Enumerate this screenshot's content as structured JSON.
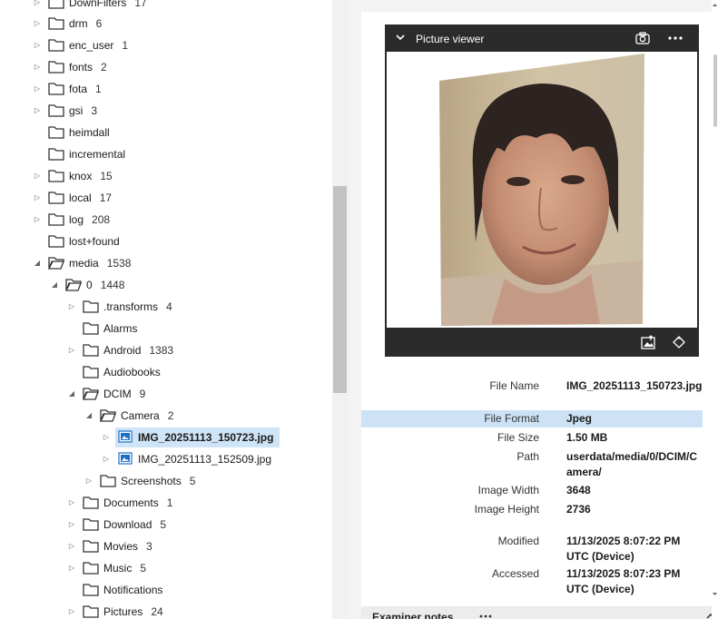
{
  "tree": {
    "rows": [
      {
        "label": "DownFilters",
        "count": "17"
      },
      {
        "label": "drm",
        "count": "6"
      },
      {
        "label": "enc_user",
        "count": "1"
      },
      {
        "label": "fonts",
        "count": "2"
      },
      {
        "label": "fota",
        "count": "1"
      },
      {
        "label": "gsi",
        "count": "3"
      },
      {
        "label": "heimdall",
        "count": ""
      },
      {
        "label": "incremental",
        "count": ""
      },
      {
        "label": "knox",
        "count": "15"
      },
      {
        "label": "local",
        "count": "17"
      },
      {
        "label": "log",
        "count": "208"
      },
      {
        "label": "lost+found",
        "count": ""
      },
      {
        "label": "media",
        "count": "1538"
      },
      {
        "label": "0",
        "count": "1448"
      },
      {
        "label": ".transforms",
        "count": "4"
      },
      {
        "label": "Alarms",
        "count": ""
      },
      {
        "label": "Android",
        "count": "1383"
      },
      {
        "label": "Audiobooks",
        "count": ""
      },
      {
        "label": "DCIM",
        "count": "9"
      },
      {
        "label": "Camera",
        "count": "2"
      },
      {
        "label": "IMG_20251113_150723.jpg",
        "count": ""
      },
      {
        "label": "IMG_20251113_152509.jpg",
        "count": ""
      },
      {
        "label": "Screenshots",
        "count": "5"
      },
      {
        "label": "Documents",
        "count": "1"
      },
      {
        "label": "Download",
        "count": "5"
      },
      {
        "label": "Movies",
        "count": "3"
      },
      {
        "label": "Music",
        "count": "5"
      },
      {
        "label": "Notifications",
        "count": ""
      },
      {
        "label": "Pictures",
        "count": "24"
      }
    ]
  },
  "viewer": {
    "title": "Picture viewer"
  },
  "properties": [
    {
      "key": "File Name",
      "value": "IMG_20251113_150723.jpg"
    },
    {
      "key": "File Format",
      "value": "Jpeg"
    },
    {
      "key": "File Size",
      "value": "1.50 MB"
    },
    {
      "key": "Path",
      "value": "userdata/media/0/DCIM/Camera/"
    },
    {
      "key": "Image Width",
      "value": "3648"
    },
    {
      "key": "Image Height",
      "value": "2736"
    },
    {
      "key": "Modified",
      "value": "11/13/2025 8:07:22 PM UTC (Device)"
    },
    {
      "key": "Accessed",
      "value": "11/13/2025 8:07:23 PM UTC (Device)"
    }
  ],
  "notes": {
    "title": "Examiner notes"
  },
  "colors": {
    "selection": "#cfe4f6",
    "viewer_bg": "#2b2b2b",
    "accent": "#1e6fc4"
  }
}
